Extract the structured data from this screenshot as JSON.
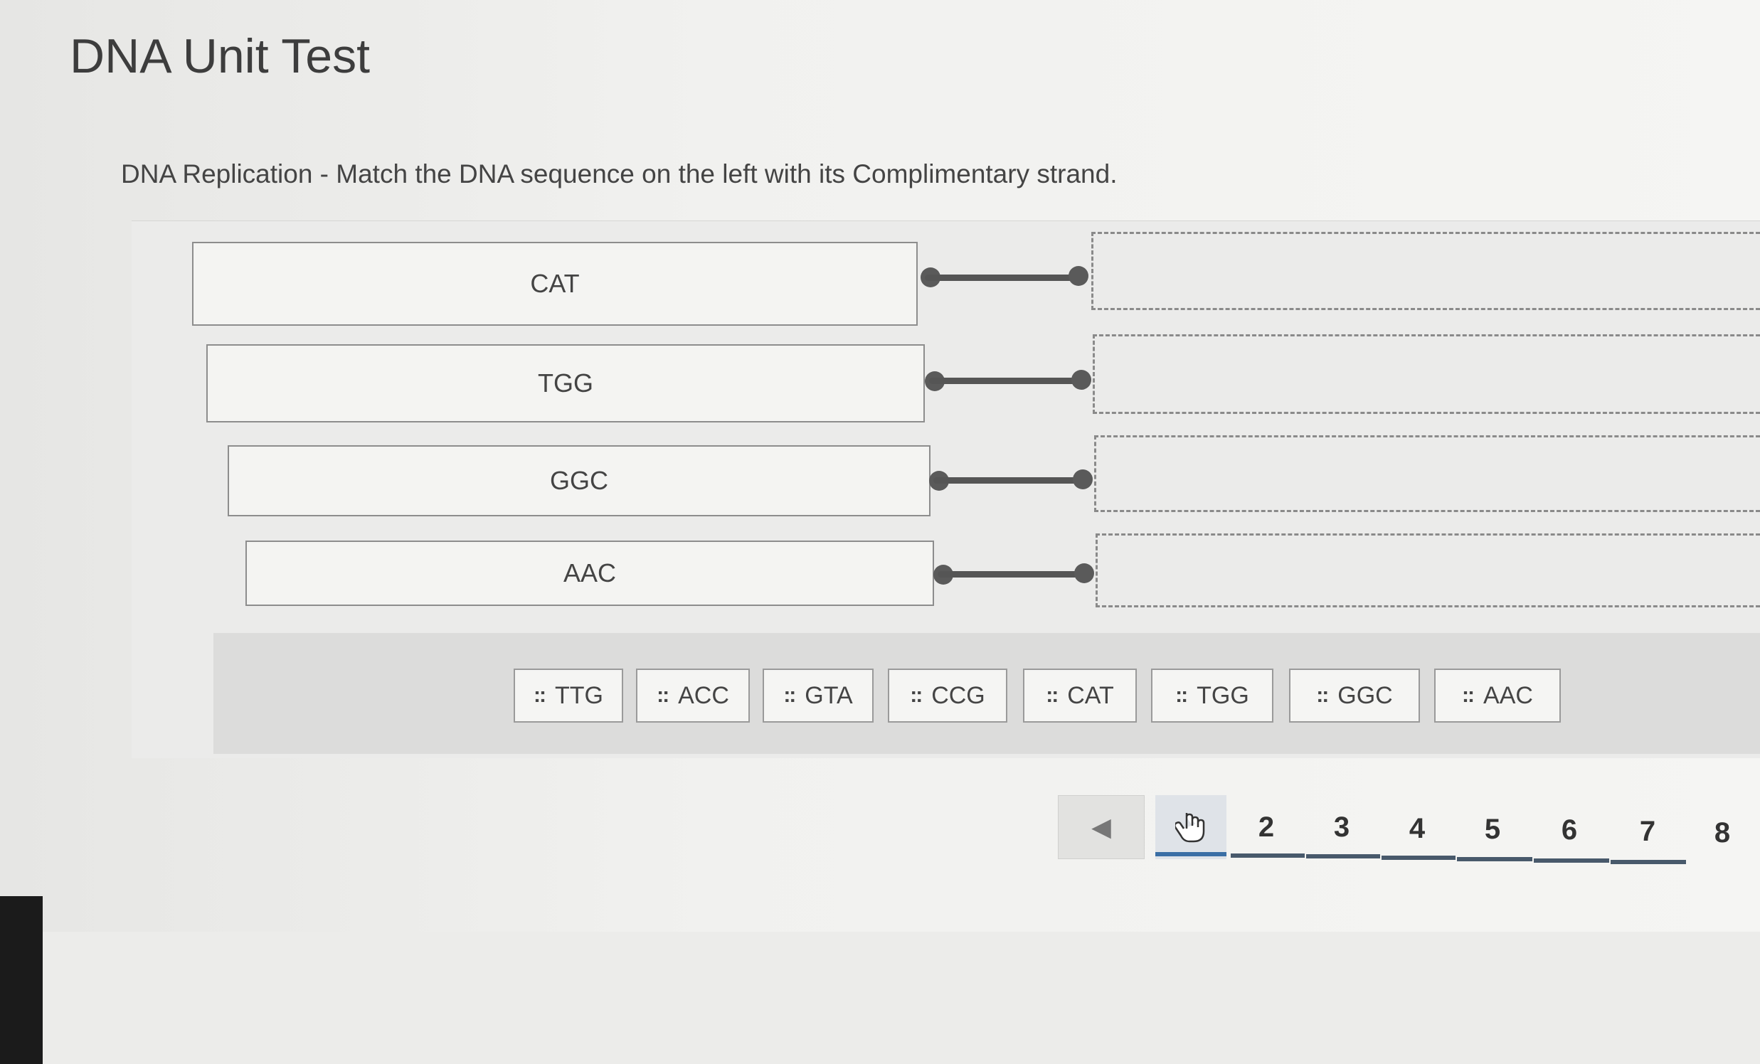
{
  "test_title": "DNA Unit Test",
  "question": "DNA Replication - Match the DNA sequence on the left with its Complimentary strand.",
  "sources": [
    {
      "label": "CAT"
    },
    {
      "label": "TGG"
    },
    {
      "label": "GGC"
    },
    {
      "label": "AAC"
    }
  ],
  "choices": [
    "TTG",
    "ACC",
    "GTA",
    "CCG",
    "CAT",
    "TGG",
    "GGC",
    "AAC"
  ],
  "grip_glyph": "::",
  "pagination": {
    "prev_icon": "◀",
    "current_icon": "hand-pointer-icon",
    "pages": [
      "2",
      "3",
      "4",
      "5",
      "6",
      "7",
      "8"
    ]
  }
}
